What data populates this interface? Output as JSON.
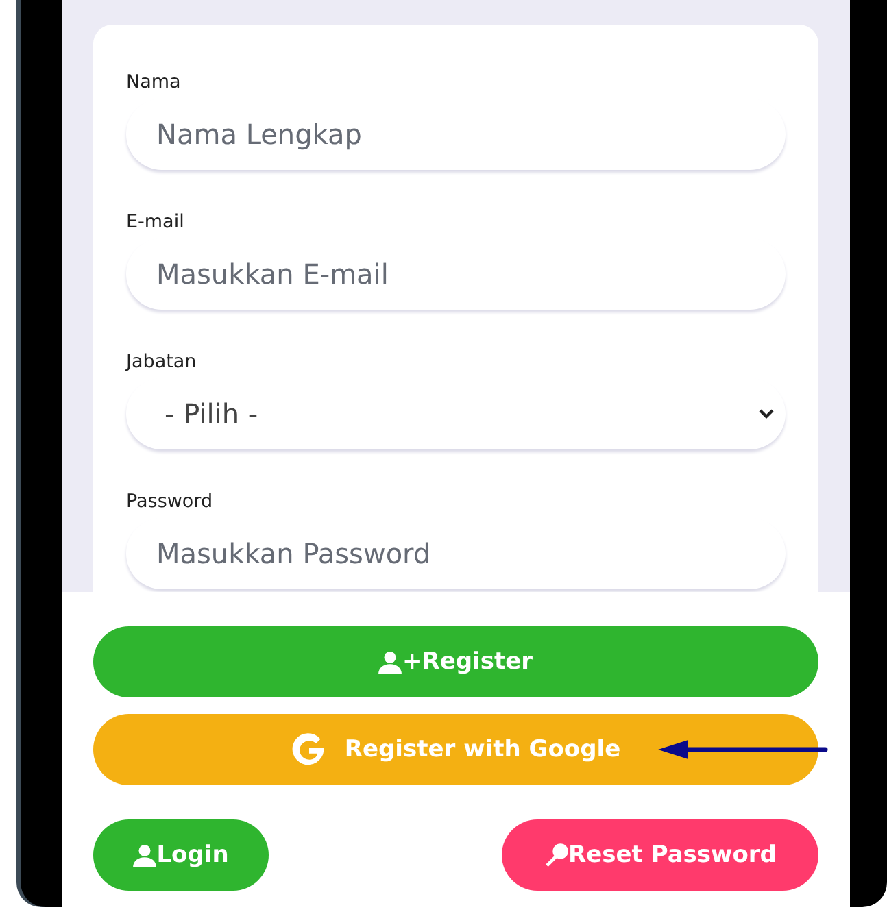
{
  "form": {
    "fields": [
      {
        "kind": "text",
        "label": "Nama",
        "placeholder": "Nama Lengkap"
      },
      {
        "kind": "text",
        "label": "E-mail",
        "placeholder": "Masukkan E-mail"
      },
      {
        "kind": "select",
        "label": "Jabatan",
        "value": "- Pilih -"
      },
      {
        "kind": "password",
        "label": "Password",
        "placeholder": "Masukkan Password"
      }
    ]
  },
  "buttons": [
    {
      "kind": "register",
      "label": "+Register"
    },
    {
      "kind": "google",
      "label": "Register with Google",
      "annotated": true
    },
    {
      "kind": "login",
      "label": "Login"
    },
    {
      "kind": "reset",
      "label": "Reset Password"
    }
  ]
}
